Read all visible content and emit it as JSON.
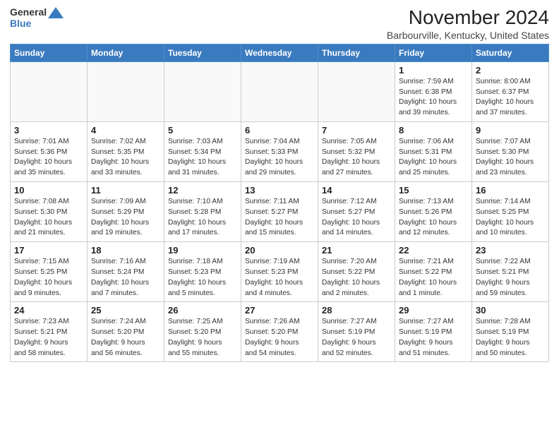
{
  "header": {
    "logo_general": "General",
    "logo_blue": "Blue",
    "title": "November 2024",
    "subtitle": "Barbourville, Kentucky, United States"
  },
  "weekdays": [
    "Sunday",
    "Monday",
    "Tuesday",
    "Wednesday",
    "Thursday",
    "Friday",
    "Saturday"
  ],
  "rows": [
    [
      {
        "day": "",
        "info": "",
        "empty": true
      },
      {
        "day": "",
        "info": "",
        "empty": true
      },
      {
        "day": "",
        "info": "",
        "empty": true
      },
      {
        "day": "",
        "info": "",
        "empty": true
      },
      {
        "day": "",
        "info": "",
        "empty": true
      },
      {
        "day": "1",
        "info": "Sunrise: 7:59 AM\nSunset: 6:38 PM\nDaylight: 10 hours\nand 39 minutes.",
        "empty": false
      },
      {
        "day": "2",
        "info": "Sunrise: 8:00 AM\nSunset: 6:37 PM\nDaylight: 10 hours\nand 37 minutes.",
        "empty": false
      }
    ],
    [
      {
        "day": "3",
        "info": "Sunrise: 7:01 AM\nSunset: 5:36 PM\nDaylight: 10 hours\nand 35 minutes.",
        "empty": false
      },
      {
        "day": "4",
        "info": "Sunrise: 7:02 AM\nSunset: 5:35 PM\nDaylight: 10 hours\nand 33 minutes.",
        "empty": false
      },
      {
        "day": "5",
        "info": "Sunrise: 7:03 AM\nSunset: 5:34 PM\nDaylight: 10 hours\nand 31 minutes.",
        "empty": false
      },
      {
        "day": "6",
        "info": "Sunrise: 7:04 AM\nSunset: 5:33 PM\nDaylight: 10 hours\nand 29 minutes.",
        "empty": false
      },
      {
        "day": "7",
        "info": "Sunrise: 7:05 AM\nSunset: 5:32 PM\nDaylight: 10 hours\nand 27 minutes.",
        "empty": false
      },
      {
        "day": "8",
        "info": "Sunrise: 7:06 AM\nSunset: 5:31 PM\nDaylight: 10 hours\nand 25 minutes.",
        "empty": false
      },
      {
        "day": "9",
        "info": "Sunrise: 7:07 AM\nSunset: 5:30 PM\nDaylight: 10 hours\nand 23 minutes.",
        "empty": false
      }
    ],
    [
      {
        "day": "10",
        "info": "Sunrise: 7:08 AM\nSunset: 5:30 PM\nDaylight: 10 hours\nand 21 minutes.",
        "empty": false
      },
      {
        "day": "11",
        "info": "Sunrise: 7:09 AM\nSunset: 5:29 PM\nDaylight: 10 hours\nand 19 minutes.",
        "empty": false
      },
      {
        "day": "12",
        "info": "Sunrise: 7:10 AM\nSunset: 5:28 PM\nDaylight: 10 hours\nand 17 minutes.",
        "empty": false
      },
      {
        "day": "13",
        "info": "Sunrise: 7:11 AM\nSunset: 5:27 PM\nDaylight: 10 hours\nand 15 minutes.",
        "empty": false
      },
      {
        "day": "14",
        "info": "Sunrise: 7:12 AM\nSunset: 5:27 PM\nDaylight: 10 hours\nand 14 minutes.",
        "empty": false
      },
      {
        "day": "15",
        "info": "Sunrise: 7:13 AM\nSunset: 5:26 PM\nDaylight: 10 hours\nand 12 minutes.",
        "empty": false
      },
      {
        "day": "16",
        "info": "Sunrise: 7:14 AM\nSunset: 5:25 PM\nDaylight: 10 hours\nand 10 minutes.",
        "empty": false
      }
    ],
    [
      {
        "day": "17",
        "info": "Sunrise: 7:15 AM\nSunset: 5:25 PM\nDaylight: 10 hours\nand 9 minutes.",
        "empty": false
      },
      {
        "day": "18",
        "info": "Sunrise: 7:16 AM\nSunset: 5:24 PM\nDaylight: 10 hours\nand 7 minutes.",
        "empty": false
      },
      {
        "day": "19",
        "info": "Sunrise: 7:18 AM\nSunset: 5:23 PM\nDaylight: 10 hours\nand 5 minutes.",
        "empty": false
      },
      {
        "day": "20",
        "info": "Sunrise: 7:19 AM\nSunset: 5:23 PM\nDaylight: 10 hours\nand 4 minutes.",
        "empty": false
      },
      {
        "day": "21",
        "info": "Sunrise: 7:20 AM\nSunset: 5:22 PM\nDaylight: 10 hours\nand 2 minutes.",
        "empty": false
      },
      {
        "day": "22",
        "info": "Sunrise: 7:21 AM\nSunset: 5:22 PM\nDaylight: 10 hours\nand 1 minute.",
        "empty": false
      },
      {
        "day": "23",
        "info": "Sunrise: 7:22 AM\nSunset: 5:21 PM\nDaylight: 9 hours\nand 59 minutes.",
        "empty": false
      }
    ],
    [
      {
        "day": "24",
        "info": "Sunrise: 7:23 AM\nSunset: 5:21 PM\nDaylight: 9 hours\nand 58 minutes.",
        "empty": false
      },
      {
        "day": "25",
        "info": "Sunrise: 7:24 AM\nSunset: 5:20 PM\nDaylight: 9 hours\nand 56 minutes.",
        "empty": false
      },
      {
        "day": "26",
        "info": "Sunrise: 7:25 AM\nSunset: 5:20 PM\nDaylight: 9 hours\nand 55 minutes.",
        "empty": false
      },
      {
        "day": "27",
        "info": "Sunrise: 7:26 AM\nSunset: 5:20 PM\nDaylight: 9 hours\nand 54 minutes.",
        "empty": false
      },
      {
        "day": "28",
        "info": "Sunrise: 7:27 AM\nSunset: 5:19 PM\nDaylight: 9 hours\nand 52 minutes.",
        "empty": false
      },
      {
        "day": "29",
        "info": "Sunrise: 7:27 AM\nSunset: 5:19 PM\nDaylight: 9 hours\nand 51 minutes.",
        "empty": false
      },
      {
        "day": "30",
        "info": "Sunrise: 7:28 AM\nSunset: 5:19 PM\nDaylight: 9 hours\nand 50 minutes.",
        "empty": false
      }
    ]
  ]
}
